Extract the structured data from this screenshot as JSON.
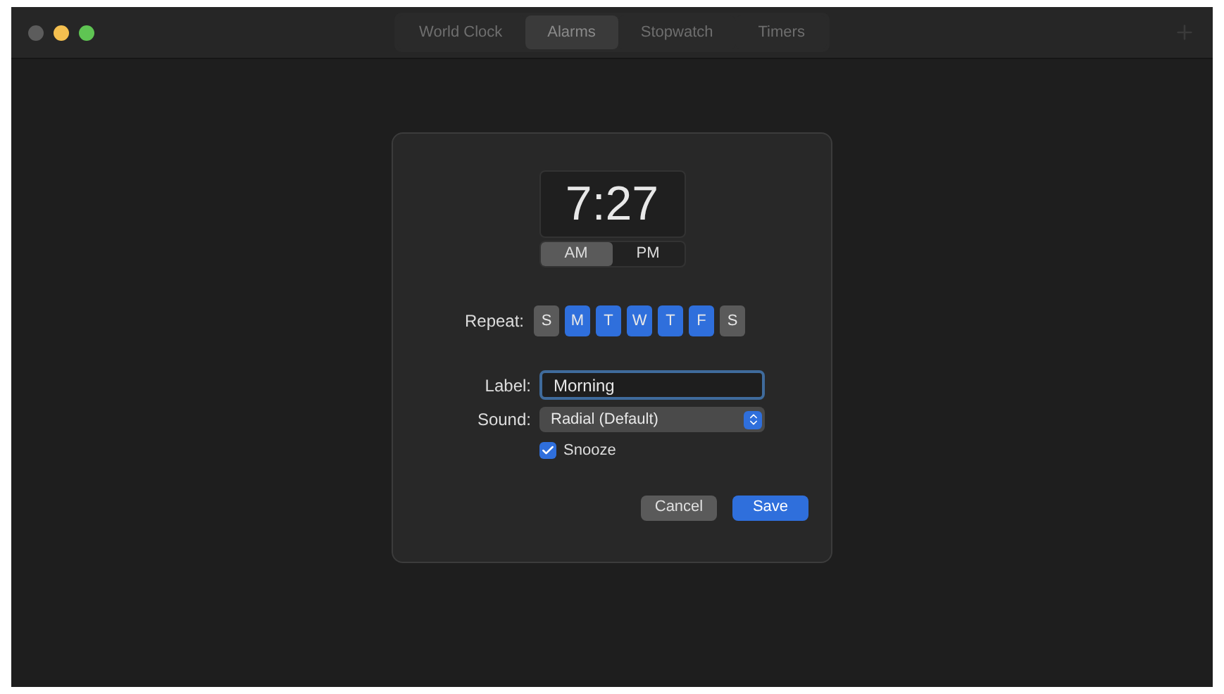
{
  "tabs": [
    {
      "label": "World Clock",
      "selected": false
    },
    {
      "label": "Alarms",
      "selected": true
    },
    {
      "label": "Stopwatch",
      "selected": false
    },
    {
      "label": "Timers",
      "selected": false
    }
  ],
  "dialog": {
    "time": "7:27",
    "periods": [
      {
        "label": "AM",
        "selected": true
      },
      {
        "label": "PM",
        "selected": false
      }
    ],
    "repeat_label": "Repeat:",
    "days": [
      {
        "label": "S",
        "selected": false
      },
      {
        "label": "M",
        "selected": true
      },
      {
        "label": "T",
        "selected": true
      },
      {
        "label": "W",
        "selected": true
      },
      {
        "label": "T",
        "selected": true
      },
      {
        "label": "F",
        "selected": true
      },
      {
        "label": "S",
        "selected": false
      }
    ],
    "label_label": "Label:",
    "label_value": "Morning",
    "sound_label": "Sound:",
    "sound_value": "Radial (Default)",
    "snooze": {
      "label": "Snooze",
      "checked": true
    },
    "buttons": [
      {
        "label": "Cancel",
        "kind": "secondary"
      },
      {
        "label": "Save",
        "kind": "primary"
      }
    ]
  }
}
